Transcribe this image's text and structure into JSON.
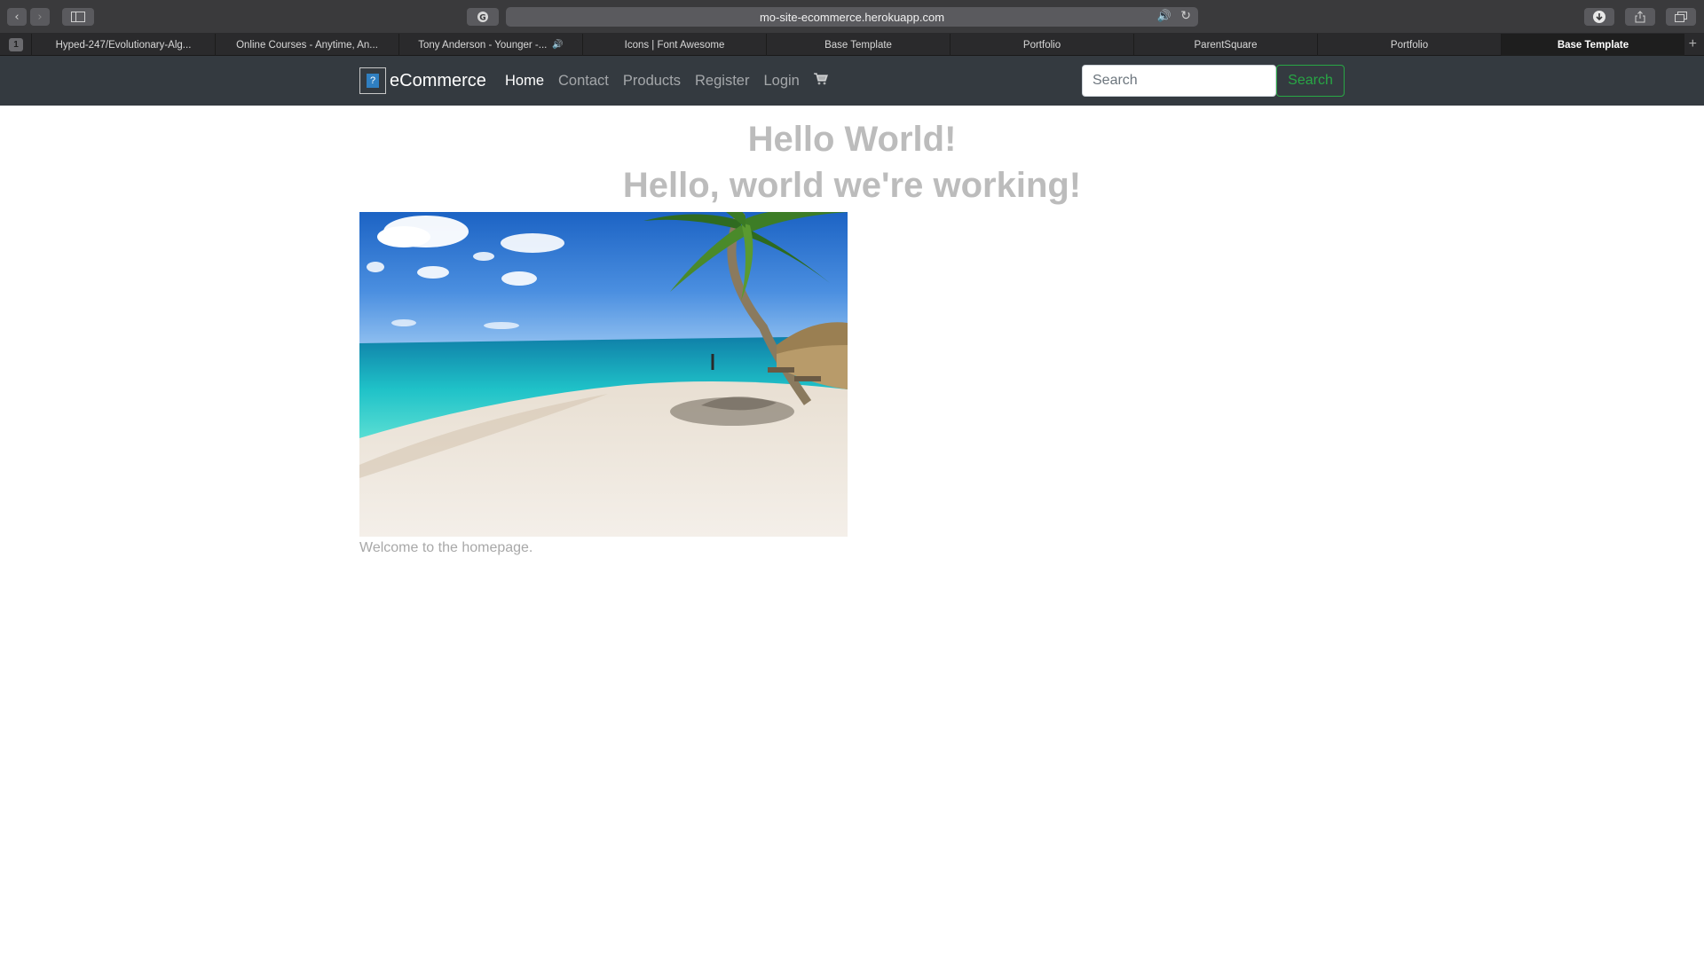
{
  "browser": {
    "url": "mo-site-ecommerce.herokuapp.com",
    "tab_count": "1",
    "tabs": [
      {
        "label": "Hyped-247/Evolutionary-Alg...",
        "audio": false
      },
      {
        "label": "Online Courses - Anytime, An...",
        "audio": false
      },
      {
        "label": "Tony Anderson - Younger -...",
        "audio": true
      },
      {
        "label": "Icons | Font Awesome",
        "audio": false
      },
      {
        "label": "Base Template",
        "audio": false
      },
      {
        "label": "Portfolio",
        "audio": false
      },
      {
        "label": "ParentSquare",
        "audio": false
      },
      {
        "label": "Portfolio",
        "audio": false
      },
      {
        "label": "Base Template",
        "audio": false,
        "active": true
      }
    ],
    "icons": [
      "back-icon",
      "forward-icon",
      "sidebar-icon",
      "extension-icon",
      "speaker-icon",
      "reload-icon",
      "download-icon",
      "share-icon",
      "tabs-overview-icon",
      "new-tab-icon"
    ]
  },
  "navbar": {
    "brand": "eCommerce",
    "brand_logo_glyph": "?",
    "links": {
      "home": "Home",
      "contact": "Contact",
      "products": "Products",
      "register": "Register",
      "login": "Login"
    },
    "cart_icon": "shopping-cart-icon",
    "search_placeholder": "Search",
    "search_button": "Search",
    "colors": {
      "background": "#343a40",
      "search_button": "#28a745"
    }
  },
  "main": {
    "heading1": "Hello World!",
    "heading2": "Hello, world we're working!",
    "hero_image": "beach-palm-tree-image",
    "welcome_text": "Welcome to the homepage."
  }
}
